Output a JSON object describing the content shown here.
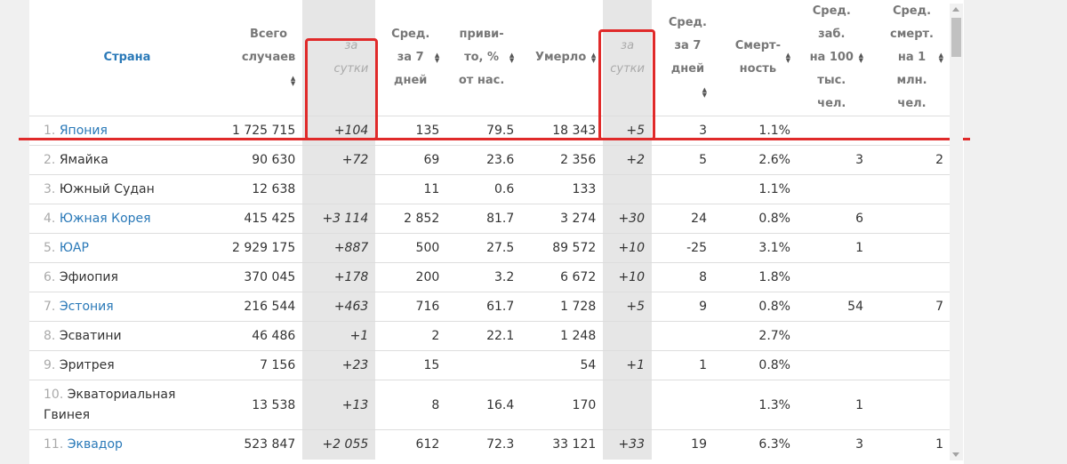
{
  "headers": {
    "country": "Страна",
    "total_cases": "Всего\nслучаев",
    "cases_per_day": "за\nсутки",
    "avg7": "Сред.\nза 7\nдней",
    "vaccinated": "приви-\nто, %\nот нас.",
    "deaths": "Умерло",
    "deaths_per_day": "за\nсутки",
    "deaths_avg7": "Сред.\nза 7\nдней",
    "mortality": "Смерт-\nность",
    "avg_per_100k": "Сред.\nзаб.\nна 100\nтыс.\nчел.",
    "avg_death_per_1m": "Сред.\nсмерт.\nна 1\nмлн.\nчел."
  },
  "rows": [
    {
      "num": "1.",
      "name": "Япония",
      "link": true,
      "total": "1 725 715",
      "day": "+104",
      "avg7": "135",
      "vacc": "79.5",
      "deaths": "18 343",
      "dday": "+5",
      "davg7": "3",
      "mort": "1.1%",
      "per100k": "",
      "per1m": ""
    },
    {
      "num": "2.",
      "name": "Ямайка",
      "link": false,
      "total": "90 630",
      "day": "+72",
      "avg7": "69",
      "vacc": "23.6",
      "deaths": "2 356",
      "dday": "+2",
      "davg7": "5",
      "mort": "2.6%",
      "per100k": "3",
      "per1m": "2"
    },
    {
      "num": "3.",
      "name": "Южный Судан",
      "link": false,
      "total": "12 638",
      "day": "",
      "avg7": "11",
      "vacc": "0.6",
      "deaths": "133",
      "dday": "",
      "davg7": "",
      "mort": "1.1%",
      "per100k": "",
      "per1m": ""
    },
    {
      "num": "4.",
      "name": "Южная Корея",
      "link": true,
      "total": "415 425",
      "day": "+3 114",
      "avg7": "2 852",
      "vacc": "81.7",
      "deaths": "3 274",
      "dday": "+30",
      "davg7": "24",
      "mort": "0.8%",
      "per100k": "6",
      "per1m": ""
    },
    {
      "num": "5.",
      "name": "ЮАР",
      "link": true,
      "total": "2 929 175",
      "day": "+887",
      "avg7": "500",
      "vacc": "27.5",
      "deaths": "89 572",
      "dday": "+10",
      "davg7": "-25",
      "mort": "3.1%",
      "per100k": "1",
      "per1m": ""
    },
    {
      "num": "6.",
      "name": "Эфиопия",
      "link": false,
      "total": "370 045",
      "day": "+178",
      "avg7": "200",
      "vacc": "3.2",
      "deaths": "6 672",
      "dday": "+10",
      "davg7": "8",
      "mort": "1.8%",
      "per100k": "",
      "per1m": ""
    },
    {
      "num": "7.",
      "name": "Эстония",
      "link": true,
      "total": "216 544",
      "day": "+463",
      "avg7": "716",
      "vacc": "61.7",
      "deaths": "1 728",
      "dday": "+5",
      "davg7": "9",
      "mort": "0.8%",
      "per100k": "54",
      "per1m": "7"
    },
    {
      "num": "8.",
      "name": "Эсватини",
      "link": false,
      "total": "46 486",
      "day": "+1",
      "avg7": "2",
      "vacc": "22.1",
      "deaths": "1 248",
      "dday": "",
      "davg7": "",
      "mort": "2.7%",
      "per100k": "",
      "per1m": ""
    },
    {
      "num": "9.",
      "name": "Эритрея",
      "link": false,
      "total": "7 156",
      "day": "+23",
      "avg7": "15",
      "vacc": "",
      "deaths": "54",
      "dday": "+1",
      "davg7": "1",
      "mort": "0.8%",
      "per100k": "",
      "per1m": ""
    },
    {
      "num": "10.",
      "name": "Экваториальная Гвинея",
      "link": false,
      "total": "13 538",
      "day": "+13",
      "avg7": "8",
      "vacc": "16.4",
      "deaths": "170",
      "dday": "",
      "davg7": "",
      "mort": "1.3%",
      "per100k": "1",
      "per1m": ""
    },
    {
      "num": "11.",
      "name": "Эквадор",
      "link": true,
      "total": "523 847",
      "day": "+2 055",
      "avg7": "612",
      "vacc": "72.3",
      "deaths": "33 121",
      "dday": "+33",
      "davg7": "19",
      "mort": "6.3%",
      "per100k": "3",
      "per1m": "1"
    }
  ],
  "colors": {
    "link": "#2a79b8",
    "highlight": "#e02a2a",
    "day_column_bg": "#e6e6e6"
  },
  "icons": {
    "sort": "sort-arrows-icon"
  }
}
